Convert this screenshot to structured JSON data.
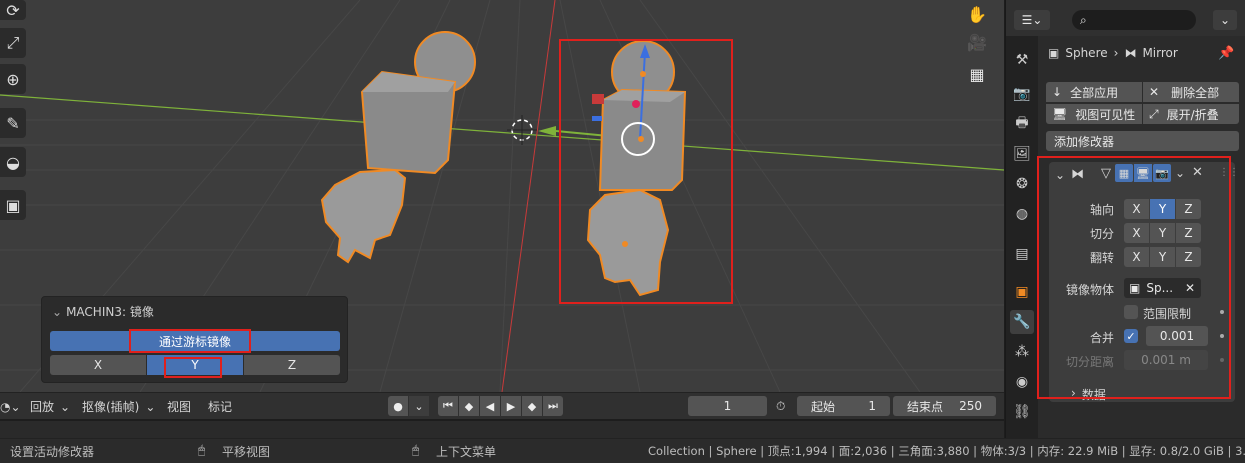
{
  "viewport": {
    "operator_panel": {
      "title": "MACHIN3: 镜像",
      "main_button": "通过游标镜像",
      "axes": [
        "X",
        "Y",
        "Z"
      ],
      "active_axis": "Y"
    },
    "icons": {
      "tools": [
        "rotate-icon",
        "scale-icon",
        "transform-icon",
        "annotate-icon",
        "measure-icon",
        "add-cube-icon"
      ],
      "nav": [
        "hand-icon",
        "camera-icon",
        "grid-icon"
      ]
    }
  },
  "timeline": {
    "playback_label": "回放",
    "keying_label": "抠像(插帧)",
    "view_label": "视图",
    "marker_label": "标记",
    "current_frame": "1",
    "start_label": "起始",
    "start_value": "1",
    "end_label": "结束点",
    "end_value": "250"
  },
  "statusbar": {
    "left_hint": "设置活动修改器",
    "middle_hint": "平移视图",
    "right_hint": "上下文菜单",
    "stats": "Collection | Sphere | 顶点:1,994 | 面:2,036 | 三角面:3,880 | 物体:3/3 | 内存: 22.9 MiB | 显存: 0.8/2.0 GiB | 3.4.1"
  },
  "properties": {
    "breadcrumb_object": "Sphere",
    "breadcrumb_modifier": "Mirror",
    "apply_all": "全部应用",
    "delete_all": "删除全部",
    "viewport_visibility": "视图可见性",
    "expand_collapse": "展开/折叠",
    "add_modifier": "添加修改器",
    "mirror": {
      "axis_label": "轴向",
      "bisect_label": "切分",
      "flip_label": "翻转",
      "axis_active": "Y",
      "axes": [
        "X",
        "Y",
        "Z"
      ],
      "mirror_object_label": "镜像物体",
      "mirror_object_value": "Sp...",
      "clipping_label": "范围限制",
      "merge_label": "合并",
      "merge_value": "0.001",
      "bisect_distance_label": "切分距离",
      "bisect_distance_value": "0.001 m",
      "data_label": "数据"
    }
  },
  "colors": {
    "accent": "#4772b3",
    "highlight_box": "#e0201c",
    "selection_outline": "#f08a24",
    "x_axis": "#c83a3a",
    "y_axis": "#7fb33a"
  }
}
